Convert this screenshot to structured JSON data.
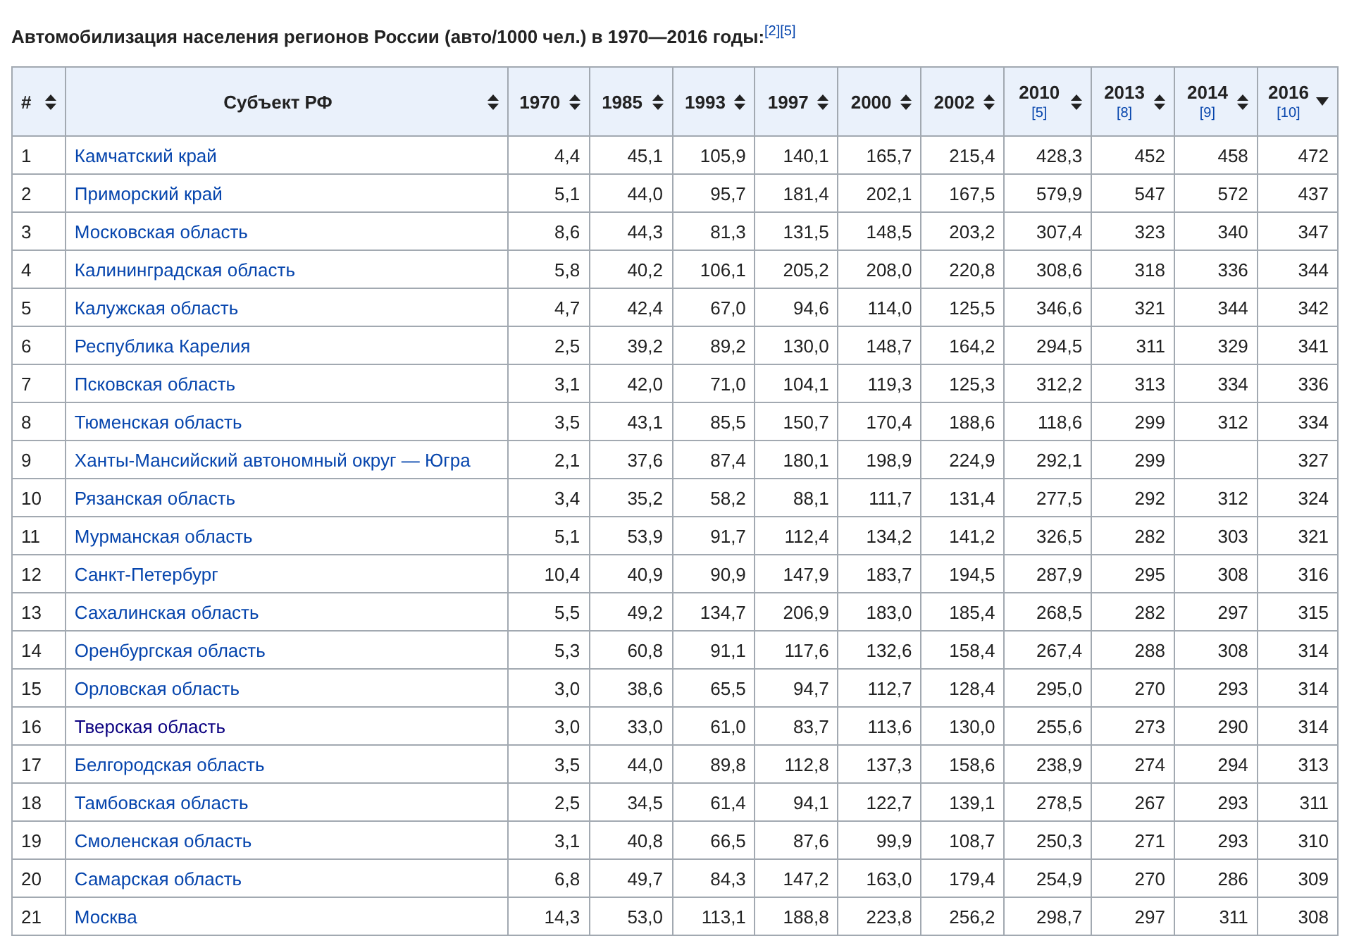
{
  "caption": {
    "text": "Автомобилизация населения регионов России (авто/1000 чел.) в 1970—2016 годы:",
    "refs": [
      "[2]",
      "[5]"
    ]
  },
  "table": {
    "columns": [
      {
        "label": "#",
        "sorted": false
      },
      {
        "label": "Субъект РФ",
        "sorted": false
      },
      {
        "label": "1970",
        "sorted": false
      },
      {
        "label": "1985",
        "sorted": false
      },
      {
        "label": "1993",
        "sorted": false
      },
      {
        "label": "1997",
        "sorted": false
      },
      {
        "label": "2000",
        "sorted": false
      },
      {
        "label": "2002",
        "sorted": false
      },
      {
        "label": "2010",
        "ref": "[5]",
        "sorted": false
      },
      {
        "label": "2013",
        "ref": "[8]",
        "sorted": false
      },
      {
        "label": "2014",
        "ref": "[9]",
        "sorted": false
      },
      {
        "label": "2016",
        "ref": "[10]",
        "sorted": true
      }
    ],
    "rows": [
      {
        "rank": "1",
        "region": "Камчатский край",
        "visited": false,
        "values": [
          "4,4",
          "45,1",
          "105,9",
          "140,1",
          "165,7",
          "215,4",
          "428,3",
          "452",
          "458",
          "472"
        ]
      },
      {
        "rank": "2",
        "region": "Приморский край",
        "visited": false,
        "values": [
          "5,1",
          "44,0",
          "95,7",
          "181,4",
          "202,1",
          "167,5",
          "579,9",
          "547",
          "572",
          "437"
        ]
      },
      {
        "rank": "3",
        "region": "Московская область",
        "visited": false,
        "values": [
          "8,6",
          "44,3",
          "81,3",
          "131,5",
          "148,5",
          "203,2",
          "307,4",
          "323",
          "340",
          "347"
        ]
      },
      {
        "rank": "4",
        "region": "Калининградская область",
        "visited": false,
        "values": [
          "5,8",
          "40,2",
          "106,1",
          "205,2",
          "208,0",
          "220,8",
          "308,6",
          "318",
          "336",
          "344"
        ]
      },
      {
        "rank": "5",
        "region": "Калужская область",
        "visited": false,
        "values": [
          "4,7",
          "42,4",
          "67,0",
          "94,6",
          "114,0",
          "125,5",
          "346,6",
          "321",
          "344",
          "342"
        ]
      },
      {
        "rank": "6",
        "region": "Республика Карелия",
        "visited": false,
        "values": [
          "2,5",
          "39,2",
          "89,2",
          "130,0",
          "148,7",
          "164,2",
          "294,5",
          "311",
          "329",
          "341"
        ]
      },
      {
        "rank": "7",
        "region": "Псковская область",
        "visited": false,
        "values": [
          "3,1",
          "42,0",
          "71,0",
          "104,1",
          "119,3",
          "125,3",
          "312,2",
          "313",
          "334",
          "336"
        ]
      },
      {
        "rank": "8",
        "region": "Тюменская область",
        "visited": false,
        "values": [
          "3,5",
          "43,1",
          "85,5",
          "150,7",
          "170,4",
          "188,6",
          "118,6",
          "299",
          "312",
          "334"
        ]
      },
      {
        "rank": "9",
        "region": "Ханты-Мансийский автономный округ — Югра",
        "visited": false,
        "values": [
          "2,1",
          "37,6",
          "87,4",
          "180,1",
          "198,9",
          "224,9",
          "292,1",
          "299",
          {
            "blank": true
          },
          "327"
        ]
      },
      {
        "rank": "10",
        "region": "Рязанская область",
        "visited": false,
        "values": [
          "3,4",
          "35,2",
          "58,2",
          "88,1",
          "111,7",
          "131,4",
          "277,5",
          "292",
          "312",
          "324"
        ]
      },
      {
        "rank": "11",
        "region": "Мурманская область",
        "visited": false,
        "values": [
          "5,1",
          "53,9",
          "91,7",
          "112,4",
          "134,2",
          "141,2",
          "326,5",
          "282",
          "303",
          "321"
        ]
      },
      {
        "rank": "12",
        "region": "Санкт-Петербург",
        "visited": false,
        "values": [
          "10,4",
          "40,9",
          "90,9",
          "147,9",
          "183,7",
          "194,5",
          "287,9",
          "295",
          "308",
          "316"
        ]
      },
      {
        "rank": "13",
        "region": "Сахалинская область",
        "visited": false,
        "values": [
          "5,5",
          "49,2",
          "134,7",
          "206,9",
          "183,0",
          "185,4",
          "268,5",
          "282",
          "297",
          "315"
        ]
      },
      {
        "rank": "14",
        "region": "Оренбургская область",
        "visited": false,
        "values": [
          "5,3",
          "60,8",
          "91,1",
          "117,6",
          "132,6",
          "158,4",
          "267,4",
          "288",
          "308",
          "314"
        ]
      },
      {
        "rank": "15",
        "region": "Орловская область",
        "visited": false,
        "values": [
          "3,0",
          "38,6",
          "65,5",
          "94,7",
          "112,7",
          "128,4",
          "295,0",
          "270",
          "293",
          "314"
        ]
      },
      {
        "rank": "16",
        "region": "Тверская область",
        "visited": true,
        "values": [
          "3,0",
          "33,0",
          "61,0",
          "83,7",
          "113,6",
          "130,0",
          "255,6",
          "273",
          "290",
          "314"
        ]
      },
      {
        "rank": "17",
        "region": "Белгородская область",
        "visited": false,
        "values": [
          "3,5",
          "44,0",
          "89,8",
          "112,8",
          "137,3",
          "158,6",
          "238,9",
          "274",
          "294",
          "313"
        ]
      },
      {
        "rank": "18",
        "region": "Тамбовская область",
        "visited": false,
        "values": [
          "2,5",
          "34,5",
          "61,4",
          "94,1",
          "122,7",
          "139,1",
          "278,5",
          "267",
          "293",
          "311"
        ]
      },
      {
        "rank": "19",
        "region": "Смоленская область",
        "visited": false,
        "values": [
          "3,1",
          "40,8",
          "66,5",
          "87,6",
          "99,9",
          "108,7",
          "250,3",
          "271",
          "293",
          "310"
        ]
      },
      {
        "rank": "20",
        "region": "Самарская область",
        "visited": false,
        "values": [
          "6,8",
          "49,7",
          "84,3",
          "147,2",
          "163,0",
          "179,4",
          "254,9",
          "270",
          "286",
          "309"
        ]
      },
      {
        "rank": "21",
        "region": "Москва",
        "visited": false,
        "values": [
          "14,3",
          "53,0",
          "113,1",
          "188,8",
          "223,8",
          "256,2",
          "298,7",
          "297",
          "311",
          "308"
        ]
      }
    ]
  }
}
